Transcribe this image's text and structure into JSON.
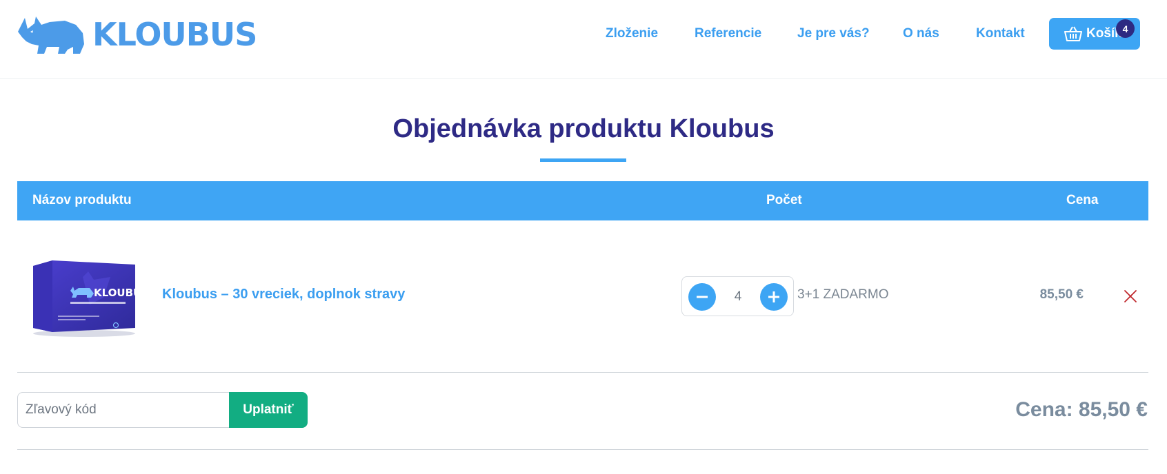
{
  "header": {
    "logo_text": "KLOUBUS",
    "nav": [
      {
        "label": "Zloženie"
      },
      {
        "label": "Referencie"
      },
      {
        "label": "Je pre vás?"
      },
      {
        "label": "O nás"
      },
      {
        "label": "Kontakt"
      }
    ],
    "cart": {
      "label": "Košík",
      "count": "4",
      "icon": "basket-icon"
    }
  },
  "page": {
    "title": "Objednávka produktu Kloubus"
  },
  "table": {
    "headers": {
      "name": "Názov produktu",
      "quantity": "Počet",
      "price": "Cena"
    },
    "rows": [
      {
        "product_name": "Kloubus – 30 vreciek, doplnok stravy",
        "box_brand": "KLOUBUS",
        "quantity": "4",
        "promo": "3+1 ZADARMO",
        "price": "85,50 €"
      }
    ]
  },
  "coupon": {
    "placeholder": "Zľavový kód",
    "apply_label": "Uplatniť"
  },
  "summary": {
    "total": "Cena: 85,50 €"
  },
  "colors": {
    "brand_blue": "#3da5f4",
    "dark_navy": "#2e2a85",
    "green": "#12ad82",
    "grey_text": "#7a8c9e",
    "remove_red": "#c0282d"
  }
}
